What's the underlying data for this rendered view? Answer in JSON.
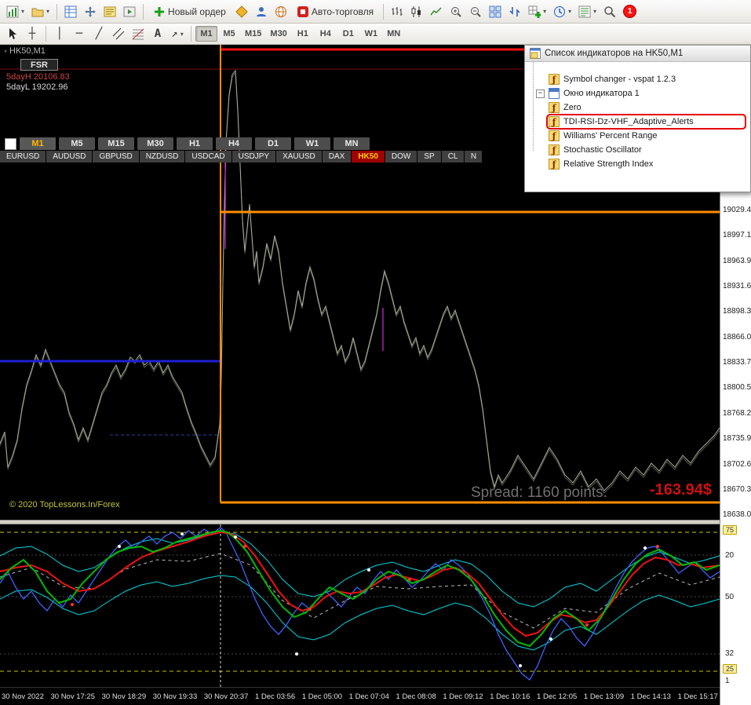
{
  "colors": {
    "accent_orange": "#ff8c00",
    "accent_red": "#ff1111",
    "accent_blue": "#1f1fd8",
    "active_symbol_bg": "#a00000",
    "pnl_red": "#cc1111"
  },
  "icons": {
    "caret_down": "▾",
    "crosshair": "┼",
    "vline": "│",
    "hline": "─",
    "trendline": "╱",
    "arrow": "↗",
    "text_tool": "A",
    "minus": "−",
    "function": "ƒ"
  },
  "toolbar_main": {
    "new_order_label": "Новый ордер",
    "auto_trading_label": "Авто-торговля",
    "notification_count": "1"
  },
  "toolbar_tools": {
    "timeframes": [
      "M1",
      "M5",
      "M15",
      "M30",
      "H1",
      "H4",
      "D1",
      "W1",
      "MN"
    ],
    "active_timeframe": "M1"
  },
  "chart": {
    "title": "HK50,M1",
    "fsr_label": "FSR",
    "day_high_label": "5dayH 20106.83",
    "day_low_label": "5dayL 19202.96",
    "copyright": "© 2020 TopLessons.In/Forex",
    "spread_label": "Spread: 1160 points.",
    "pnl_label": "-163.94$",
    "timeframe_buttons": [
      "M1",
      "M5",
      "M15",
      "M30",
      "H1",
      "H4",
      "D1",
      "W1",
      "MN"
    ],
    "active_timeframe": "M1",
    "symbol_buttons": [
      "EURUSD",
      "AUDUSD",
      "GBPUSD",
      "NZDUSD",
      "USDCAD",
      "USDJPY",
      "XAUUSD",
      "DAX",
      "HK50",
      "DOW",
      "SP",
      "CL",
      "N"
    ],
    "active_symbol": "HK50",
    "price_scale": [
      "19029.45",
      "18997.15",
      "18963.90",
      "18931.60",
      "18898.35",
      "18866.05",
      "18833.75",
      "18800.50",
      "18768.20",
      "18735.90",
      "18702.65",
      "18670.35",
      "18638.05"
    ]
  },
  "indicator_popup": {
    "title": "Список индикаторов на HK50,M1",
    "items": [
      {
        "label": "Symbol changer - vspat 1.2.3",
        "highlighted": false
      },
      {
        "label": "Окно индикатора 1",
        "highlighted": false
      },
      {
        "label": "Zero",
        "highlighted": false
      },
      {
        "label": "TDI-RSI-Dz-VHF_Adaptive_Alerts",
        "highlighted": true
      },
      {
        "label": "Williams' Percent Range",
        "highlighted": false
      },
      {
        "label": "Stochastic Oscillator",
        "highlighted": false
      },
      {
        "label": "Relative Strength Index",
        "highlighted": false
      }
    ]
  },
  "indicator_panel": {
    "scale_labels": [
      "75",
      "20",
      "50",
      "32",
      "25",
      "1"
    ]
  },
  "time_axis": {
    "labels": [
      "30 Nov 2022",
      "30 Nov 17:25",
      "30 Nov 18:29",
      "30 Nov 19:33",
      "30 Nov 20:37",
      "1 Dec 03:56",
      "1 Dec 05:00",
      "1 Dec 07:04",
      "1 Dec 08:08",
      "1 Dec 09:12",
      "1 Dec 10:16",
      "1 Dec 12:05",
      "1 Dec 13:09",
      "1 Dec 14:13",
      "1 Dec 15:17"
    ]
  }
}
